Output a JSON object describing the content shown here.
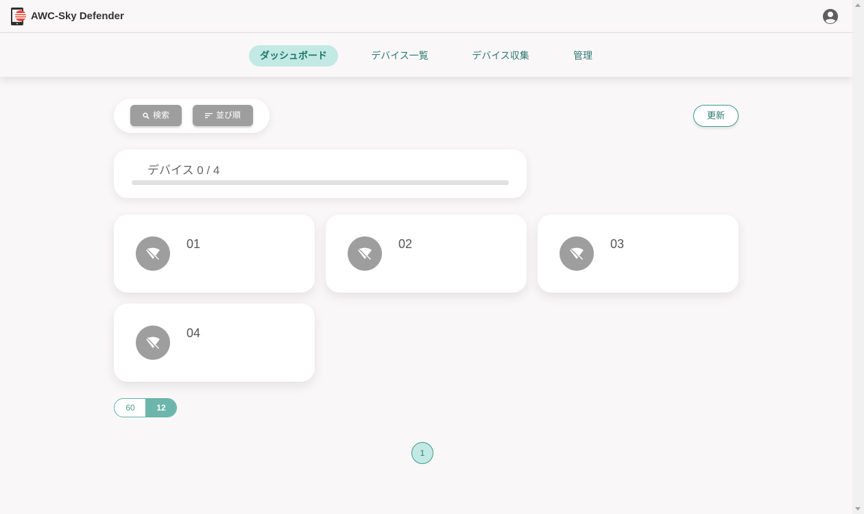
{
  "app": {
    "title": "AWC-Sky Defender",
    "logo_icon": "tablet-logo-icon",
    "account_icon": "account-circle-icon"
  },
  "nav": {
    "tabs": [
      {
        "label": "ダッシュボード",
        "active": true
      },
      {
        "label": "デバイス一覧",
        "active": false
      },
      {
        "label": "デバイス収集",
        "active": false
      },
      {
        "label": "管理",
        "active": false
      }
    ]
  },
  "toolbar": {
    "search_label": "検索",
    "search_icon": "search-icon",
    "sort_label": "並び順",
    "sort_icon": "sort-icon",
    "refresh_label": "更新"
  },
  "device_count": {
    "label": "デバイス 0 / 4",
    "online": 0,
    "total": 4
  },
  "devices": [
    {
      "name": "01",
      "status_icon": "wifi-off-icon"
    },
    {
      "name": "02",
      "status_icon": "wifi-off-icon"
    },
    {
      "name": "03",
      "status_icon": "wifi-off-icon"
    },
    {
      "name": "04",
      "status_icon": "wifi-off-icon"
    }
  ],
  "page_size": {
    "options": [
      "60",
      "12"
    ],
    "selected": "12"
  },
  "pagination": {
    "current_page": "1"
  },
  "colors": {
    "accent": "#3c9a8d",
    "active_tab_bg": "#c2e9e4",
    "offline_icon_bg": "#9e9e9e",
    "background": "#faf7f8"
  }
}
